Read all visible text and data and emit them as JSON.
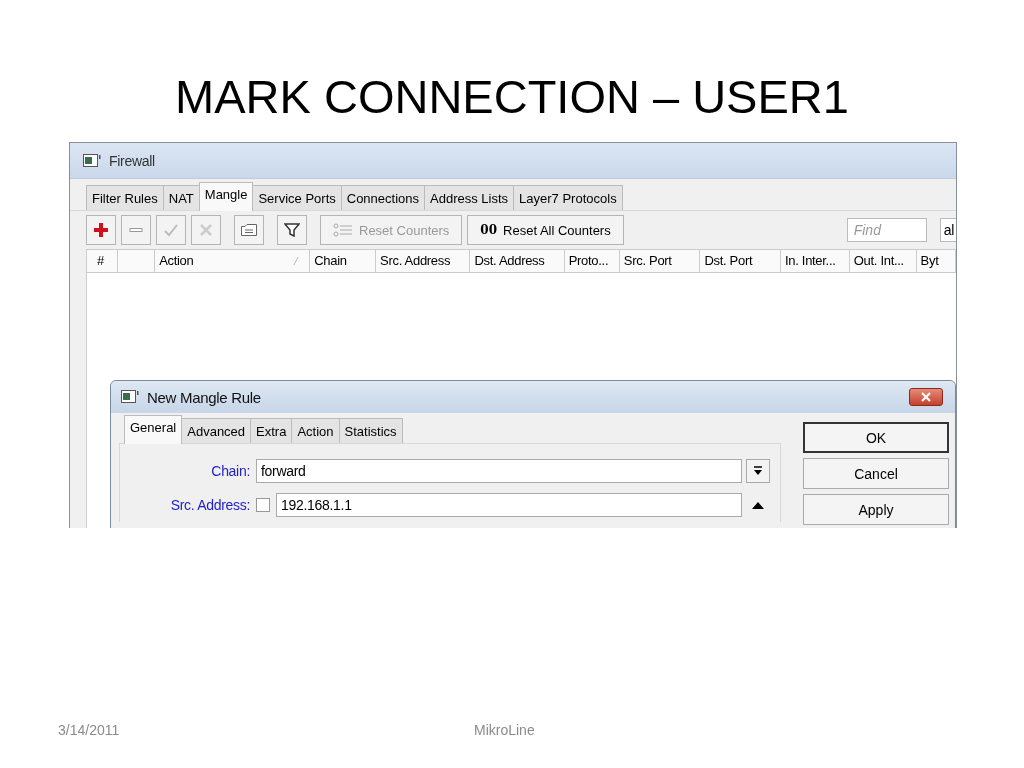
{
  "slide": {
    "title": "MARK CONNECTION – USER1",
    "footer_date": "3/14/2011",
    "footer_center": "MikroLine"
  },
  "window": {
    "title": "Firewall",
    "tabs": [
      {
        "label": "Filter Rules",
        "selected": false
      },
      {
        "label": "NAT",
        "selected": false
      },
      {
        "label": "Mangle",
        "selected": true
      },
      {
        "label": "Service Ports",
        "selected": false
      },
      {
        "label": "Connections",
        "selected": false
      },
      {
        "label": "Address Lists",
        "selected": false
      },
      {
        "label": "Layer7 Protocols",
        "selected": false
      }
    ],
    "toolbar": [
      {
        "kind": "add",
        "disabled": false
      },
      {
        "kind": "remove",
        "disabled": false
      },
      {
        "kind": "enable",
        "disabled": true
      },
      {
        "kind": "disable",
        "disabled": true
      },
      {
        "kind": "comment",
        "disabled": false
      },
      {
        "kind": "filter",
        "disabled": false
      },
      {
        "kind": "text",
        "label": "Reset Counters",
        "disabled": true
      },
      {
        "kind": "text",
        "icon_text": "00",
        "label": "Reset All Counters",
        "disabled": false
      }
    ],
    "find": {
      "placeholder": "Find"
    },
    "dropdown_value": "al",
    "table": {
      "columns": [
        {
          "label": "#",
          "sorted": false
        },
        {
          "label": "Action",
          "sorted": true
        },
        {
          "label": "Chain",
          "sorted": false
        },
        {
          "label": "Src. Address",
          "sorted": false
        },
        {
          "label": "Dst. Address",
          "sorted": false
        },
        {
          "label": "Proto...",
          "sorted": false
        },
        {
          "label": "Src. Port",
          "sorted": false
        },
        {
          "label": "Dst. Port",
          "sorted": false
        },
        {
          "label": "In. Inter...",
          "sorted": false
        },
        {
          "label": "Out. Int...",
          "sorted": false
        },
        {
          "label": "Byt",
          "sorted": false
        }
      ]
    }
  },
  "dialog": {
    "title": "New Mangle Rule",
    "tabs": [
      {
        "label": "General",
        "selected": true
      },
      {
        "label": "Advanced",
        "selected": false
      },
      {
        "label": "Extra",
        "selected": false
      },
      {
        "label": "Action",
        "selected": false
      },
      {
        "label": "Statistics",
        "selected": false
      }
    ],
    "fields": [
      {
        "kind": "dropdown",
        "label": "Chain:",
        "value": "forward"
      },
      {
        "kind": "invertible",
        "label": "Src. Address:",
        "value": "192.168.1.1",
        "checked": false
      }
    ],
    "buttons": [
      {
        "label": "OK",
        "default": true
      },
      {
        "label": "Cancel",
        "default": false
      },
      {
        "label": "Apply",
        "default": false
      }
    ]
  }
}
